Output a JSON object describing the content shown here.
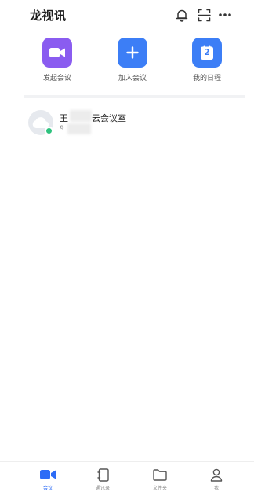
{
  "header": {
    "title": "龙视讯",
    "bell_icon": "bell-icon",
    "scan_icon": "scan-icon",
    "more_icon": "more-icon"
  },
  "quick_actions": [
    {
      "label": "发起会议",
      "icon": "video-camera-icon",
      "color": "#8a5cf0"
    },
    {
      "label": "加入会议",
      "icon": "plus-icon",
      "color": "#3c7ef6"
    },
    {
      "label": "我的日程",
      "icon": "calendar-icon",
      "color": "#3c7ef6",
      "calendar_day": "2"
    }
  ],
  "rooms": [
    {
      "name": "王",
      "name_suffix": "云会议室",
      "id_prefix": "9",
      "status": "online"
    }
  ],
  "tabs": [
    {
      "label": "会议",
      "icon": "meeting-icon",
      "active": true
    },
    {
      "label": "通讯录",
      "icon": "contacts-icon",
      "active": false
    },
    {
      "label": "文件夹",
      "icon": "folder-icon",
      "active": false
    },
    {
      "label": "我",
      "icon": "person-icon",
      "active": false
    }
  ],
  "colors": {
    "accent": "#2d6cf6",
    "online": "#2ec27e",
    "text_muted": "#888888"
  }
}
